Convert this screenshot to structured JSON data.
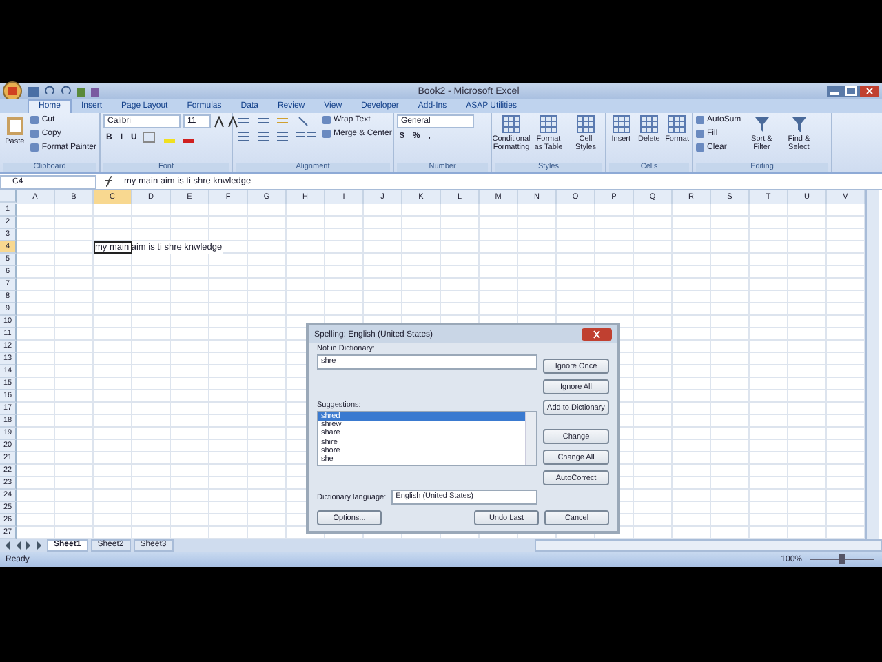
{
  "window": {
    "title": "Book2 - Microsoft Excel"
  },
  "tabs": [
    {
      "label": "Home",
      "selected": true
    },
    {
      "label": "Insert",
      "selected": false
    },
    {
      "label": "Page Layout",
      "selected": false
    },
    {
      "label": "Formulas",
      "selected": false
    },
    {
      "label": "Data",
      "selected": false
    },
    {
      "label": "Review",
      "selected": false
    },
    {
      "label": "View",
      "selected": false
    },
    {
      "label": "Developer",
      "selected": false
    },
    {
      "label": "Add-Ins",
      "selected": false
    },
    {
      "label": "ASAP Utilities",
      "selected": false
    }
  ],
  "ribbon": [
    {
      "kind": "clipboard",
      "label": "Clipboard",
      "big": "Paste",
      "small": [
        "Cut",
        "Copy",
        "Format Painter"
      ]
    },
    {
      "kind": "font",
      "label": "Font",
      "font": "Calibri",
      "size": "11",
      "styles": [
        "B",
        "I",
        "U"
      ]
    },
    {
      "kind": "alignment",
      "label": "Alignment",
      "commands": [
        "Wrap Text",
        "Merge & Center"
      ]
    },
    {
      "kind": "number",
      "label": "Number",
      "format": "General",
      "symbols": [
        "$",
        "%",
        ","
      ]
    },
    {
      "kind": "big",
      "label": "Styles",
      "buttons": [
        "Conditional Formatting",
        "Format as Table",
        "Cell Styles"
      ]
    },
    {
      "kind": "big",
      "label": "Cells",
      "buttons": [
        "Insert",
        "Delete",
        "Format"
      ]
    },
    {
      "kind": "editing",
      "label": "Editing",
      "small": [
        "AutoSum",
        "Fill",
        "Clear"
      ],
      "buttons": [
        "Sort & Filter",
        "Find & Select"
      ]
    }
  ],
  "formula_bar": {
    "name_box": "C4",
    "formula": "my main aim is ti shre knwledge"
  },
  "sheet": {
    "columns": [
      {
        "label": "A",
        "selected": false
      },
      {
        "label": "B",
        "selected": false
      },
      {
        "label": "C",
        "selected": true
      },
      {
        "label": "D",
        "selected": false
      },
      {
        "label": "E",
        "selected": false
      },
      {
        "label": "F",
        "selected": false
      },
      {
        "label": "G",
        "selected": false
      },
      {
        "label": "H",
        "selected": false
      },
      {
        "label": "I",
        "selected": false
      },
      {
        "label": "J",
        "selected": false
      },
      {
        "label": "K",
        "selected": false
      },
      {
        "label": "L",
        "selected": false
      },
      {
        "label": "M",
        "selected": false
      },
      {
        "label": "N",
        "selected": false
      },
      {
        "label": "O",
        "selected": false
      },
      {
        "label": "P",
        "selected": false
      },
      {
        "label": "Q",
        "selected": false
      },
      {
        "label": "R",
        "selected": false
      },
      {
        "label": "S",
        "selected": false
      },
      {
        "label": "T",
        "selected": false
      },
      {
        "label": "U",
        "selected": false
      },
      {
        "label": "V",
        "selected": false
      }
    ],
    "rows": [
      {
        "label": "1",
        "selected": false
      },
      {
        "label": "2",
        "selected": false
      },
      {
        "label": "3",
        "selected": false
      },
      {
        "label": "4",
        "selected": true
      },
      {
        "label": "5",
        "selected": false
      },
      {
        "label": "6",
        "selected": false
      },
      {
        "label": "7",
        "selected": false
      },
      {
        "label": "8",
        "selected": false
      },
      {
        "label": "9",
        "selected": false
      },
      {
        "label": "10",
        "selected": false
      },
      {
        "label": "11",
        "selected": false
      },
      {
        "label": "12",
        "selected": false
      },
      {
        "label": "13",
        "selected": false
      },
      {
        "label": "14",
        "selected": false
      },
      {
        "label": "15",
        "selected": false
      },
      {
        "label": "16",
        "selected": false
      },
      {
        "label": "17",
        "selected": false
      },
      {
        "label": "18",
        "selected": false
      },
      {
        "label": "19",
        "selected": false
      },
      {
        "label": "20",
        "selected": false
      },
      {
        "label": "21",
        "selected": false
      },
      {
        "label": "22",
        "selected": false
      },
      {
        "label": "23",
        "selected": false
      },
      {
        "label": "24",
        "selected": false
      },
      {
        "label": "25",
        "selected": false
      },
      {
        "label": "26",
        "selected": false
      },
      {
        "label": "27",
        "selected": false
      }
    ],
    "cell_text": "my main aim is ti shre knwledge"
  },
  "dialog": {
    "title": "Spelling: English (United States)",
    "not_in_dictionary_label": "Not in Dictionary:",
    "not_in_dictionary": "shre",
    "suggestions_label": "Suggestions:",
    "suggestions": [
      {
        "text": "shred",
        "selected": true
      },
      {
        "text": "shrew",
        "selected": false
      },
      {
        "text": "share",
        "selected": false
      },
      {
        "text": "shire",
        "selected": false
      },
      {
        "text": "shore",
        "selected": false
      },
      {
        "text": "she",
        "selected": false
      }
    ],
    "side_buttons": [
      "Ignore Once",
      "Ignore All",
      "Add to Dictionary",
      "Change",
      "Change All",
      "AutoCorrect"
    ],
    "language_label": "Dictionary language:",
    "language": "English (United States)",
    "bottom_buttons": [
      "Options...",
      "Undo Last",
      "Cancel"
    ]
  },
  "sheet_tabs": [
    {
      "label": "Sheet1",
      "selected": true
    },
    {
      "label": "Sheet2",
      "selected": false
    },
    {
      "label": "Sheet3",
      "selected": false
    }
  ],
  "status_bar": {
    "status": "Ready",
    "zoom": "100%"
  }
}
